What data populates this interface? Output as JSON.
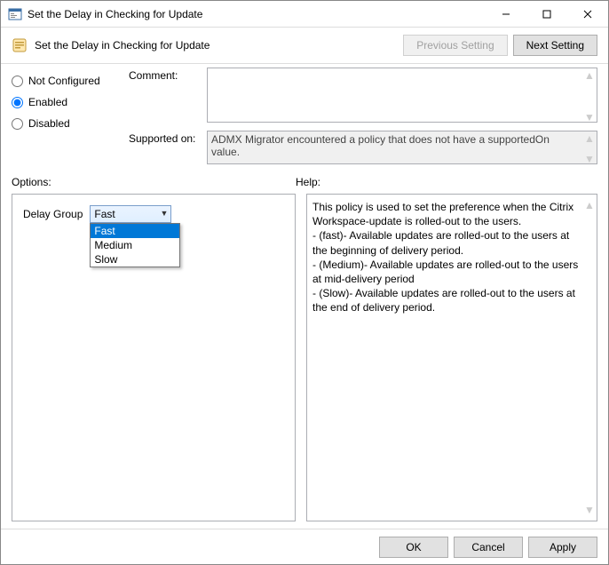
{
  "window": {
    "title": "Set the Delay in Checking for Update"
  },
  "header": {
    "subtitle": "Set the Delay in Checking for Update",
    "prev_label": "Previous Setting",
    "next_label": "Next Setting"
  },
  "state": {
    "not_configured_label": "Not Configured",
    "enabled_label": "Enabled",
    "disabled_label": "Disabled",
    "selected": "enabled"
  },
  "fields": {
    "comment_label": "Comment:",
    "comment_value": "",
    "supported_label": "Supported on:",
    "supported_value": "ADMX Migrator encountered a policy that does not have a supportedOn value."
  },
  "section_labels": {
    "options": "Options:",
    "help": "Help:"
  },
  "options": {
    "delay_group_label": "Delay Group",
    "delay_group_selected": "Fast",
    "delay_group_choices": [
      "Fast",
      "Medium",
      "Slow"
    ]
  },
  "help_text": "This policy is used to set the preference when the Citrix Workspace-update is rolled-out to the users.\n- (fast)- Available updates are rolled-out to the users at the beginning of delivery period.\n- (Medium)- Available updates are rolled-out to the users at mid-delivery period\n- (Slow)- Available updates are rolled-out to the users at the end of delivery period.",
  "footer": {
    "ok": "OK",
    "cancel": "Cancel",
    "apply": "Apply"
  }
}
